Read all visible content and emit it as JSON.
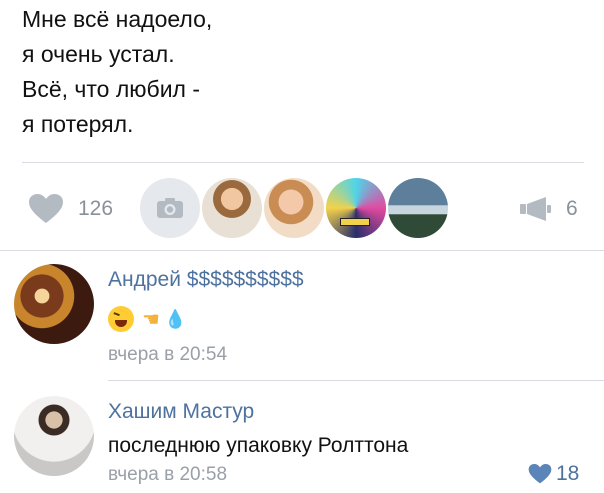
{
  "post": {
    "lines": [
      "Мне всё надоело,",
      "я очень устал.",
      "Всё, что любил -",
      "я потерял."
    ]
  },
  "actions": {
    "likes": "126",
    "shares": "6",
    "like_icon": "heart-icon",
    "share_icon": "megaphone-icon",
    "camera_icon": "camera-icon"
  },
  "comments": [
    {
      "author": "Андрей $$$$$$$$$$",
      "text": "",
      "emoji": [
        "😆",
        "👈",
        "💦"
      ],
      "time": "вчера в 20:54"
    },
    {
      "author": "Хашим Мастур",
      "text": "последнюю упаковку Ролттона",
      "time": "вчера в 20:58",
      "likes": "18"
    }
  ],
  "colors": {
    "link": "#4e72a0",
    "muted": "#8a9099",
    "divider": "#d8dce2"
  }
}
